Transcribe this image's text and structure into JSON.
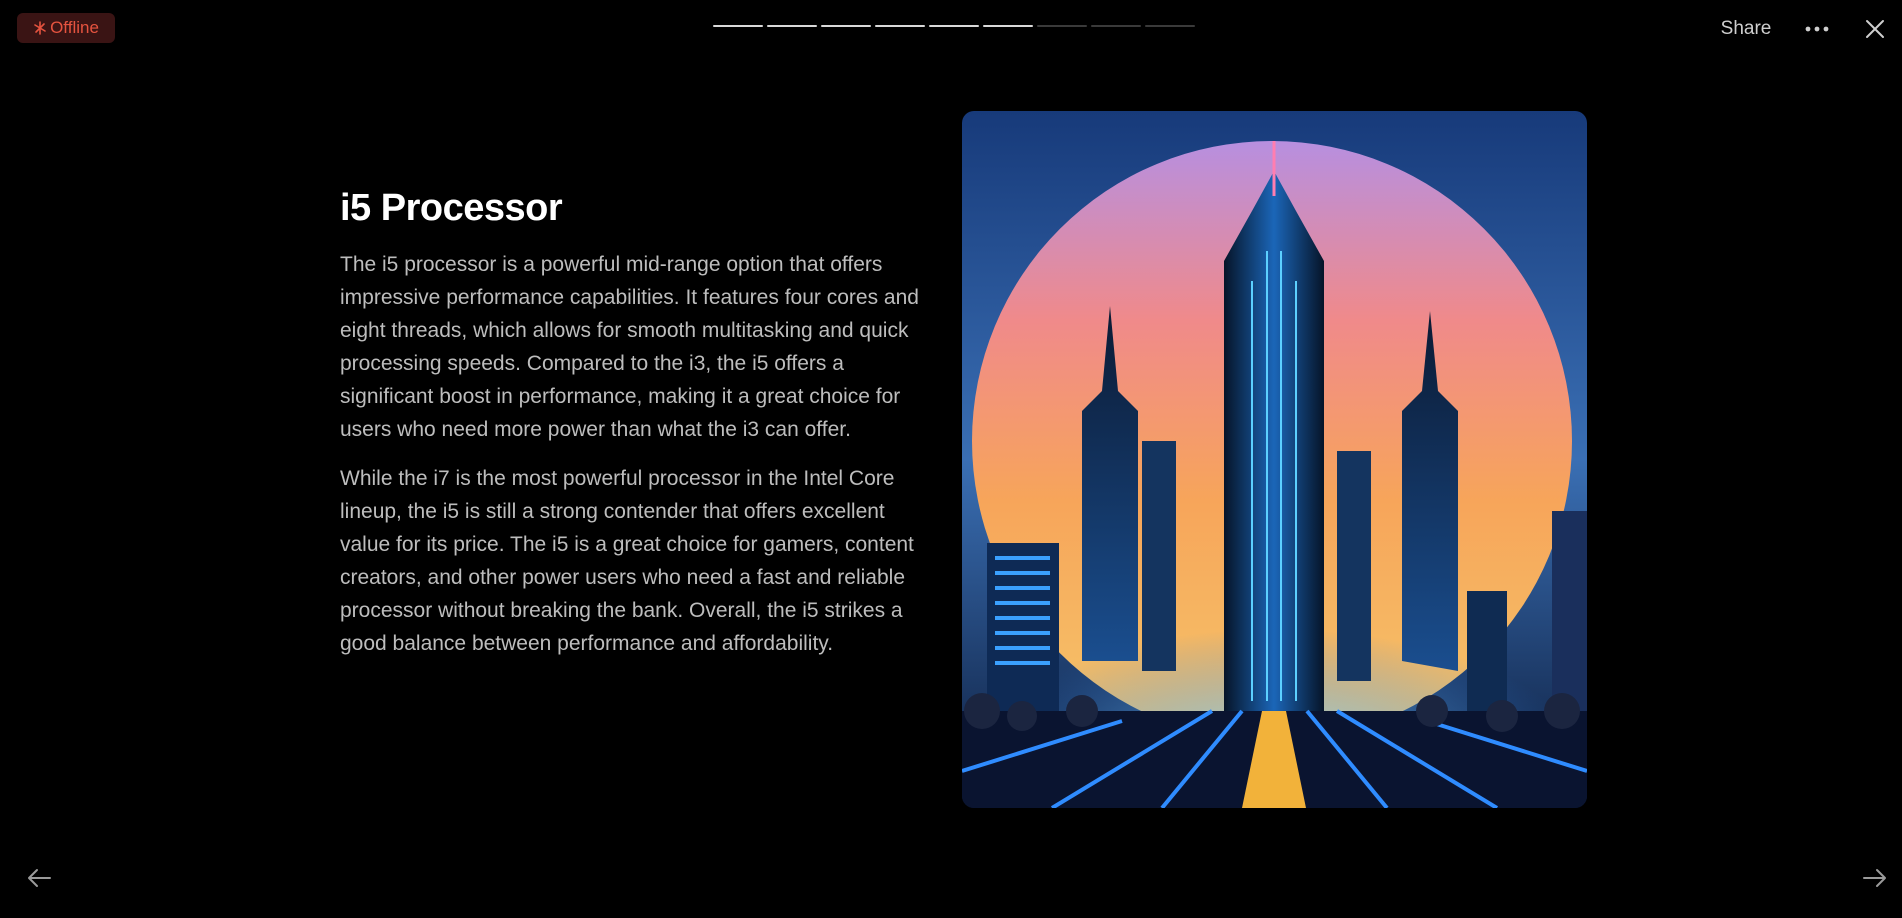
{
  "status": {
    "label": "Offline",
    "icon": "no-signal-icon",
    "color": "#e5533f"
  },
  "progress": {
    "total": 9,
    "current": 6
  },
  "header": {
    "share_label": "Share",
    "more_icon": "more-horizontal-icon",
    "close_icon": "close-icon"
  },
  "slide": {
    "title": "i5 Processor",
    "paragraphs": [
      "The i5 processor is a powerful mid-range option that offers impressive performance capabilities. It features four cores and eight threads, which allows for smooth multitasking and quick processing speeds. Compared to the i3, the i5 offers a significant boost in performance, making it a great choice for users who need more power than what the i3 can offer.",
      "While the i7 is the most powerful processor in the Intel Core lineup, the i5 is still a strong contender that offers excellent value for its price. The i5 is a great choice for gamers, content creators, and other power users who need a fast and reliable processor without breaking the bank. Overall, the i5 strikes a good balance between performance and affordability."
    ]
  },
  "navigation": {
    "prev_icon": "arrow-left-icon",
    "next_icon": "arrow-right-icon"
  }
}
